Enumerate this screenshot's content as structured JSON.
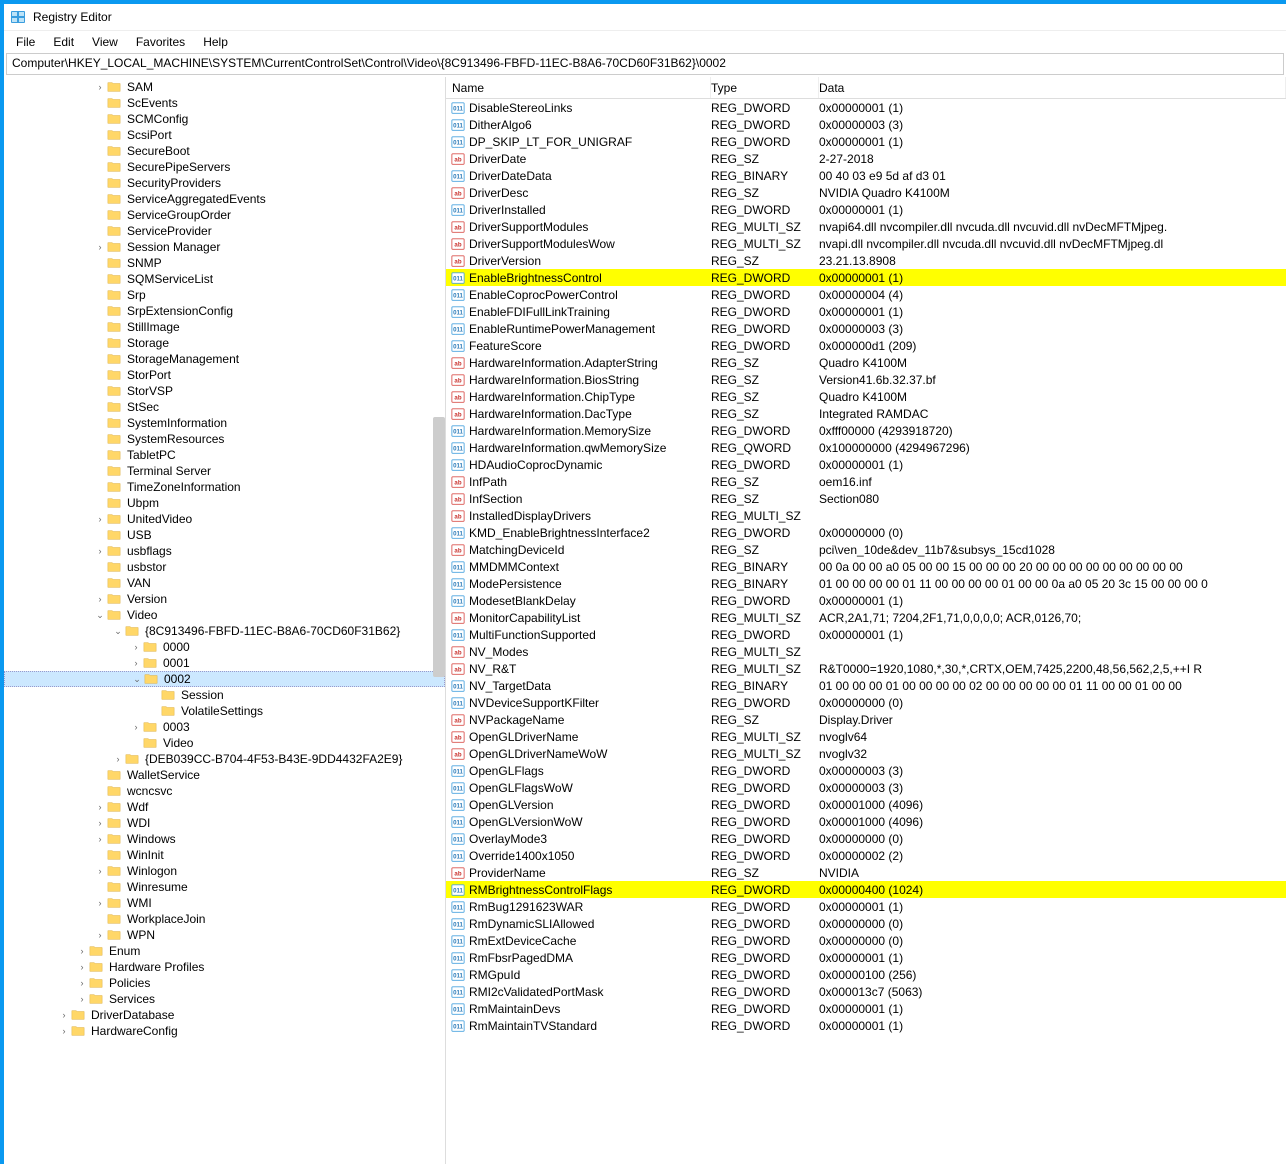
{
  "window": {
    "title": "Registry Editor"
  },
  "menu": {
    "items": [
      "File",
      "Edit",
      "View",
      "Favorites",
      "Help"
    ]
  },
  "addressbar": "Computer\\HKEY_LOCAL_MACHINE\\SYSTEM\\CurrentControlSet\\Control\\Video\\{8C913496-FBFD-11EC-B8A6-70CD60F31B62}\\0002",
  "tree": [
    {
      "depth": 5,
      "exp": ">",
      "label": "SAM"
    },
    {
      "depth": 5,
      "exp": "",
      "label": "ScEvents"
    },
    {
      "depth": 5,
      "exp": "",
      "label": "SCMConfig"
    },
    {
      "depth": 5,
      "exp": "",
      "label": "ScsiPort"
    },
    {
      "depth": 5,
      "exp": "",
      "label": "SecureBoot"
    },
    {
      "depth": 5,
      "exp": "",
      "label": "SecurePipeServers"
    },
    {
      "depth": 5,
      "exp": "",
      "label": "SecurityProviders"
    },
    {
      "depth": 5,
      "exp": "",
      "label": "ServiceAggregatedEvents"
    },
    {
      "depth": 5,
      "exp": "",
      "label": "ServiceGroupOrder"
    },
    {
      "depth": 5,
      "exp": "",
      "label": "ServiceProvider"
    },
    {
      "depth": 5,
      "exp": ">",
      "label": "Session Manager"
    },
    {
      "depth": 5,
      "exp": "",
      "label": "SNMP"
    },
    {
      "depth": 5,
      "exp": "",
      "label": "SQMServiceList"
    },
    {
      "depth": 5,
      "exp": "",
      "label": "Srp"
    },
    {
      "depth": 5,
      "exp": "",
      "label": "SrpExtensionConfig"
    },
    {
      "depth": 5,
      "exp": "",
      "label": "StillImage"
    },
    {
      "depth": 5,
      "exp": "",
      "label": "Storage"
    },
    {
      "depth": 5,
      "exp": "",
      "label": "StorageManagement"
    },
    {
      "depth": 5,
      "exp": "",
      "label": "StorPort"
    },
    {
      "depth": 5,
      "exp": "",
      "label": "StorVSP"
    },
    {
      "depth": 5,
      "exp": "",
      "label": "StSec"
    },
    {
      "depth": 5,
      "exp": "",
      "label": "SystemInformation"
    },
    {
      "depth": 5,
      "exp": "",
      "label": "SystemResources"
    },
    {
      "depth": 5,
      "exp": "",
      "label": "TabletPC"
    },
    {
      "depth": 5,
      "exp": "",
      "label": "Terminal Server"
    },
    {
      "depth": 5,
      "exp": "",
      "label": "TimeZoneInformation"
    },
    {
      "depth": 5,
      "exp": "",
      "label": "Ubpm"
    },
    {
      "depth": 5,
      "exp": ">",
      "label": "UnitedVideo"
    },
    {
      "depth": 5,
      "exp": "",
      "label": "USB"
    },
    {
      "depth": 5,
      "exp": ">",
      "label": "usbflags"
    },
    {
      "depth": 5,
      "exp": "",
      "label": "usbstor"
    },
    {
      "depth": 5,
      "exp": "",
      "label": "VAN"
    },
    {
      "depth": 5,
      "exp": ">",
      "label": "Version"
    },
    {
      "depth": 5,
      "exp": "v",
      "label": "Video"
    },
    {
      "depth": 6,
      "exp": "v",
      "label": "{8C913496-FBFD-11EC-B8A6-70CD60F31B62}"
    },
    {
      "depth": 7,
      "exp": ">",
      "label": "0000"
    },
    {
      "depth": 7,
      "exp": ">",
      "label": "0001"
    },
    {
      "depth": 7,
      "exp": "v",
      "label": "0002",
      "selected": true
    },
    {
      "depth": 8,
      "exp": "",
      "label": "Session"
    },
    {
      "depth": 8,
      "exp": "",
      "label": "VolatileSettings"
    },
    {
      "depth": 7,
      "exp": ">",
      "label": "0003"
    },
    {
      "depth": 7,
      "exp": "",
      "label": "Video"
    },
    {
      "depth": 6,
      "exp": ">",
      "label": "{DEB039CC-B704-4F53-B43E-9DD4432FA2E9}"
    },
    {
      "depth": 5,
      "exp": "",
      "label": "WalletService"
    },
    {
      "depth": 5,
      "exp": "",
      "label": "wcncsvc"
    },
    {
      "depth": 5,
      "exp": ">",
      "label": "Wdf"
    },
    {
      "depth": 5,
      "exp": ">",
      "label": "WDI"
    },
    {
      "depth": 5,
      "exp": ">",
      "label": "Windows"
    },
    {
      "depth": 5,
      "exp": "",
      "label": "WinInit"
    },
    {
      "depth": 5,
      "exp": ">",
      "label": "Winlogon"
    },
    {
      "depth": 5,
      "exp": "",
      "label": "Winresume"
    },
    {
      "depth": 5,
      "exp": ">",
      "label": "WMI"
    },
    {
      "depth": 5,
      "exp": "",
      "label": "WorkplaceJoin"
    },
    {
      "depth": 5,
      "exp": ">",
      "label": "WPN"
    },
    {
      "depth": 4,
      "exp": ">",
      "label": "Enum"
    },
    {
      "depth": 4,
      "exp": ">",
      "label": "Hardware Profiles"
    },
    {
      "depth": 4,
      "exp": ">",
      "label": "Policies"
    },
    {
      "depth": 4,
      "exp": ">",
      "label": "Services"
    },
    {
      "depth": 3,
      "exp": ">",
      "label": "DriverDatabase"
    },
    {
      "depth": 3,
      "exp": ">",
      "label": "HardwareConfig"
    }
  ],
  "columns": {
    "name": "Name",
    "type": "Type",
    "data": "Data"
  },
  "values": [
    {
      "icon": "dw",
      "name": "DisableStereoLinks",
      "type": "REG_DWORD",
      "data": "0x00000001 (1)"
    },
    {
      "icon": "dw",
      "name": "DitherAlgo6",
      "type": "REG_DWORD",
      "data": "0x00000003 (3)"
    },
    {
      "icon": "dw",
      "name": "DP_SKIP_LT_FOR_UNIGRAF",
      "type": "REG_DWORD",
      "data": "0x00000001 (1)"
    },
    {
      "icon": "sz",
      "name": "DriverDate",
      "type": "REG_SZ",
      "data": "2-27-2018"
    },
    {
      "icon": "dw",
      "name": "DriverDateData",
      "type": "REG_BINARY",
      "data": "00 40 03 e9 5d af d3 01"
    },
    {
      "icon": "sz",
      "name": "DriverDesc",
      "type": "REG_SZ",
      "data": "NVIDIA Quadro K4100M"
    },
    {
      "icon": "dw",
      "name": "DriverInstalled",
      "type": "REG_DWORD",
      "data": "0x00000001 (1)"
    },
    {
      "icon": "sz",
      "name": "DriverSupportModules",
      "type": "REG_MULTI_SZ",
      "data": "nvapi64.dll nvcompiler.dll nvcuda.dll nvcuvid.dll nvDecMFTMjpeg."
    },
    {
      "icon": "sz",
      "name": "DriverSupportModulesWow",
      "type": "REG_MULTI_SZ",
      "data": "nvapi.dll nvcompiler.dll nvcuda.dll nvcuvid.dll nvDecMFTMjpeg.dl"
    },
    {
      "icon": "sz",
      "name": "DriverVersion",
      "type": "REG_SZ",
      "data": "23.21.13.8908"
    },
    {
      "icon": "dw",
      "name": "EnableBrightnessControl",
      "type": "REG_DWORD",
      "data": "0x00000001 (1)",
      "hl": true
    },
    {
      "icon": "dw",
      "name": "EnableCoprocPowerControl",
      "type": "REG_DWORD",
      "data": "0x00000004 (4)"
    },
    {
      "icon": "dw",
      "name": "EnableFDIFullLinkTraining",
      "type": "REG_DWORD",
      "data": "0x00000001 (1)"
    },
    {
      "icon": "dw",
      "name": "EnableRuntimePowerManagement",
      "type": "REG_DWORD",
      "data": "0x00000003 (3)"
    },
    {
      "icon": "dw",
      "name": "FeatureScore",
      "type": "REG_DWORD",
      "data": "0x000000d1 (209)"
    },
    {
      "icon": "sz",
      "name": "HardwareInformation.AdapterString",
      "type": "REG_SZ",
      "data": "Quadro K4100M"
    },
    {
      "icon": "sz",
      "name": "HardwareInformation.BiosString",
      "type": "REG_SZ",
      "data": "Version41.6b.32.37.bf"
    },
    {
      "icon": "sz",
      "name": "HardwareInformation.ChipType",
      "type": "REG_SZ",
      "data": "Quadro K4100M"
    },
    {
      "icon": "sz",
      "name": "HardwareInformation.DacType",
      "type": "REG_SZ",
      "data": "Integrated RAMDAC"
    },
    {
      "icon": "dw",
      "name": "HardwareInformation.MemorySize",
      "type": "REG_DWORD",
      "data": "0xfff00000 (4293918720)"
    },
    {
      "icon": "dw",
      "name": "HardwareInformation.qwMemorySize",
      "type": "REG_QWORD",
      "data": "0x100000000 (4294967296)"
    },
    {
      "icon": "dw",
      "name": "HDAudioCoprocDynamic",
      "type": "REG_DWORD",
      "data": "0x00000001 (1)"
    },
    {
      "icon": "sz",
      "name": "InfPath",
      "type": "REG_SZ",
      "data": "oem16.inf"
    },
    {
      "icon": "sz",
      "name": "InfSection",
      "type": "REG_SZ",
      "data": "Section080"
    },
    {
      "icon": "sz",
      "name": "InstalledDisplayDrivers",
      "type": "REG_MULTI_SZ",
      "data": ""
    },
    {
      "icon": "dw",
      "name": "KMD_EnableBrightnessInterface2",
      "type": "REG_DWORD",
      "data": "0x00000000 (0)"
    },
    {
      "icon": "sz",
      "name": "MatchingDeviceId",
      "type": "REG_SZ",
      "data": "pci\\ven_10de&dev_11b7&subsys_15cd1028"
    },
    {
      "icon": "dw",
      "name": "MMDMMContext",
      "type": "REG_BINARY",
      "data": "00 0a 00 00 a0 05 00 00 15 00 00 00 20 00 00 00 00 00 00 00 00 00"
    },
    {
      "icon": "dw",
      "name": "ModePersistence",
      "type": "REG_BINARY",
      "data": "01 00 00 00 00 01 11 00 00 00 00 01 00 00 0a a0 05 20 3c 15 00 00 00 0"
    },
    {
      "icon": "dw",
      "name": "ModesetBlankDelay",
      "type": "REG_DWORD",
      "data": "0x00000001 (1)"
    },
    {
      "icon": "sz",
      "name": "MonitorCapabilityList",
      "type": "REG_MULTI_SZ",
      "data": "ACR,2A1,71; 7204,2F1,71,0,0,0,0; ACR,0126,70;"
    },
    {
      "icon": "dw",
      "name": "MultiFunctionSupported",
      "type": "REG_DWORD",
      "data": "0x00000001 (1)"
    },
    {
      "icon": "sz",
      "name": "NV_Modes",
      "type": "REG_MULTI_SZ",
      "data": ""
    },
    {
      "icon": "sz",
      "name": "NV_R&T",
      "type": "REG_MULTI_SZ",
      "data": "R&T0000=1920,1080,*,30,*,CRTX,OEM,7425,2200,48,56,562,2,5,++I R"
    },
    {
      "icon": "dw",
      "name": "NV_TargetData",
      "type": "REG_BINARY",
      "data": "01 00 00 00 01 00 00 00 00 02 00 00 00 00 00 01 11 00 00 01 00 00"
    },
    {
      "icon": "dw",
      "name": "NVDeviceSupportKFilter",
      "type": "REG_DWORD",
      "data": "0x00000000 (0)"
    },
    {
      "icon": "sz",
      "name": "NVPackageName",
      "type": "REG_SZ",
      "data": "Display.Driver"
    },
    {
      "icon": "sz",
      "name": "OpenGLDriverName",
      "type": "REG_MULTI_SZ",
      "data": "nvoglv64"
    },
    {
      "icon": "sz",
      "name": "OpenGLDriverNameWoW",
      "type": "REG_MULTI_SZ",
      "data": "nvoglv32"
    },
    {
      "icon": "dw",
      "name": "OpenGLFlags",
      "type": "REG_DWORD",
      "data": "0x00000003 (3)"
    },
    {
      "icon": "dw",
      "name": "OpenGLFlagsWoW",
      "type": "REG_DWORD",
      "data": "0x00000003 (3)"
    },
    {
      "icon": "dw",
      "name": "OpenGLVersion",
      "type": "REG_DWORD",
      "data": "0x00001000 (4096)"
    },
    {
      "icon": "dw",
      "name": "OpenGLVersionWoW",
      "type": "REG_DWORD",
      "data": "0x00001000 (4096)"
    },
    {
      "icon": "dw",
      "name": "OverlayMode3",
      "type": "REG_DWORD",
      "data": "0x00000000 (0)"
    },
    {
      "icon": "dw",
      "name": "Override1400x1050",
      "type": "REG_DWORD",
      "data": "0x00000002 (2)"
    },
    {
      "icon": "sz",
      "name": "ProviderName",
      "type": "REG_SZ",
      "data": "NVIDIA"
    },
    {
      "icon": "dw",
      "name": "RMBrightnessControlFlags",
      "type": "REG_DWORD",
      "data": "0x00000400 (1024)",
      "hl": true
    },
    {
      "icon": "dw",
      "name": "RmBug1291623WAR",
      "type": "REG_DWORD",
      "data": "0x00000001 (1)"
    },
    {
      "icon": "dw",
      "name": "RmDynamicSLIAllowed",
      "type": "REG_DWORD",
      "data": "0x00000000 (0)"
    },
    {
      "icon": "dw",
      "name": "RmExtDeviceCache",
      "type": "REG_DWORD",
      "data": "0x00000000 (0)"
    },
    {
      "icon": "dw",
      "name": "RmFbsrPagedDMA",
      "type": "REG_DWORD",
      "data": "0x00000001 (1)"
    },
    {
      "icon": "dw",
      "name": "RMGpuId",
      "type": "REG_DWORD",
      "data": "0x00000100 (256)"
    },
    {
      "icon": "dw",
      "name": "RMI2cValidatedPortMask",
      "type": "REG_DWORD",
      "data": "0x000013c7 (5063)"
    },
    {
      "icon": "dw",
      "name": "RmMaintainDevs",
      "type": "REG_DWORD",
      "data": "0x00000001 (1)"
    },
    {
      "icon": "dw",
      "name": "RmMaintainTVStandard",
      "type": "REG_DWORD",
      "data": "0x00000001 (1)"
    }
  ]
}
